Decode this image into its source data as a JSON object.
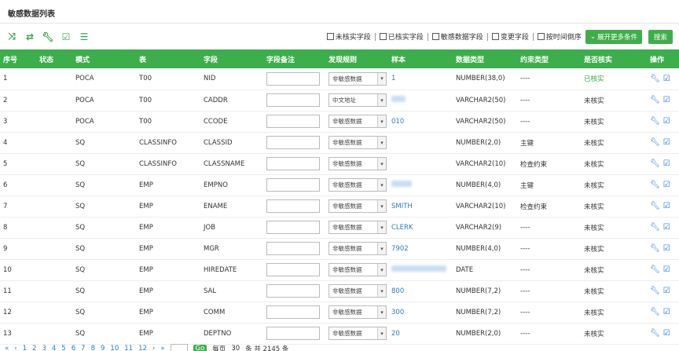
{
  "panel_title": "敏感数据列表",
  "filters": [
    {
      "label": "未核实字段"
    },
    {
      "label": "已核实字段"
    },
    {
      "label": "敏感数据字段"
    },
    {
      "label": "变更字段"
    },
    {
      "label": "按时间倒序"
    }
  ],
  "expand_button": "展开更多条件",
  "search_button": "搜索",
  "columns": [
    "序号",
    "状态",
    "模式",
    "表",
    "字段",
    "字段备注",
    "发现规则",
    "样本",
    "数据类型",
    "约束类型",
    "是否核实",
    "操作"
  ],
  "rows": [
    {
      "no": "1",
      "status": "",
      "schema": "POCA",
      "table": "T00",
      "field": "NID",
      "rule": "非敏感数据",
      "sample": "1",
      "type": "NUMBER(38,0)",
      "constraint": "----",
      "verified": "已核实"
    },
    {
      "no": "2",
      "status": "",
      "schema": "POCA",
      "table": "T00",
      "field": "CADDR",
      "rule": "中文地址",
      "sample": "",
      "type": "VARCHAR2(50)",
      "constraint": "----",
      "verified": "未核实"
    },
    {
      "no": "3",
      "status": "",
      "schema": "POCA",
      "table": "T00",
      "field": "CCODE",
      "rule": "非敏感数据",
      "sample": "010",
      "type": "VARCHAR2(50)",
      "constraint": "----",
      "verified": "未核实"
    },
    {
      "no": "4",
      "status": "",
      "schema": "SQ",
      "table": "CLASSINFO",
      "field": "CLASSID",
      "rule": "非敏感数据",
      "sample": "",
      "type": "NUMBER(2,0)",
      "constraint": "主键",
      "verified": "未核实"
    },
    {
      "no": "5",
      "status": "",
      "schema": "SQ",
      "table": "CLASSINFO",
      "field": "CLASSNAME",
      "rule": "非敏感数据",
      "sample": "",
      "type": "VARCHAR2(10)",
      "constraint": "检查约束",
      "verified": "未核实"
    },
    {
      "no": "6",
      "status": "",
      "schema": "SQ",
      "table": "EMP",
      "field": "EMPNO",
      "rule": "非敏感数据",
      "sample": "",
      "type": "NUMBER(4,0)",
      "constraint": "主键",
      "verified": "未核实"
    },
    {
      "no": "7",
      "status": "",
      "schema": "SQ",
      "table": "EMP",
      "field": "ENAME",
      "rule": "非敏感数据",
      "sample": "SMITH",
      "type": "VARCHAR2(10)",
      "constraint": "检查约束",
      "verified": "未核实"
    },
    {
      "no": "8",
      "status": "",
      "schema": "SQ",
      "table": "EMP",
      "field": "JOB",
      "rule": "非敏感数据",
      "sample": "CLERK",
      "type": "VARCHAR2(9)",
      "constraint": "----",
      "verified": "未核实"
    },
    {
      "no": "9",
      "status": "",
      "schema": "SQ",
      "table": "EMP",
      "field": "MGR",
      "rule": "非敏感数据",
      "sample": "7902",
      "type": "NUMBER(4,0)",
      "constraint": "----",
      "verified": "未核实"
    },
    {
      "no": "10",
      "status": "",
      "schema": "SQ",
      "table": "EMP",
      "field": "HIREDATE",
      "rule": "非敏感数据",
      "sample": "",
      "type": "DATE",
      "constraint": "----",
      "verified": "未核实"
    },
    {
      "no": "11",
      "status": "",
      "schema": "SQ",
      "table": "EMP",
      "field": "SAL",
      "rule": "非敏感数据",
      "sample": "800",
      "type": "NUMBER(7,2)",
      "constraint": "----",
      "verified": "未核实"
    },
    {
      "no": "12",
      "status": "",
      "schema": "SQ",
      "table": "EMP",
      "field": "COMM",
      "rule": "非敏感数据",
      "sample": "300",
      "type": "NUMBER(7,2)",
      "constraint": "----",
      "verified": "未核实"
    },
    {
      "no": "13",
      "status": "",
      "schema": "SQ",
      "table": "EMP",
      "field": "DEPTNO",
      "rule": "非敏感数据",
      "sample": "20",
      "type": "NUMBER(2,0)",
      "constraint": "----",
      "verified": "未核实"
    }
  ],
  "pagination": {
    "first": "«",
    "prev": "‹",
    "pages": [
      "1",
      "2",
      "3",
      "4",
      "5",
      "6",
      "7",
      "8",
      "9",
      "10",
      "11",
      "12"
    ],
    "next": "›",
    "last": "»",
    "go": "Go",
    "per_page_label": "每页",
    "per_page": "30",
    "total_label": "条 共 2145 条"
  },
  "colors": {
    "accent": "#3cae4b",
    "link": "#2a7cc7"
  }
}
